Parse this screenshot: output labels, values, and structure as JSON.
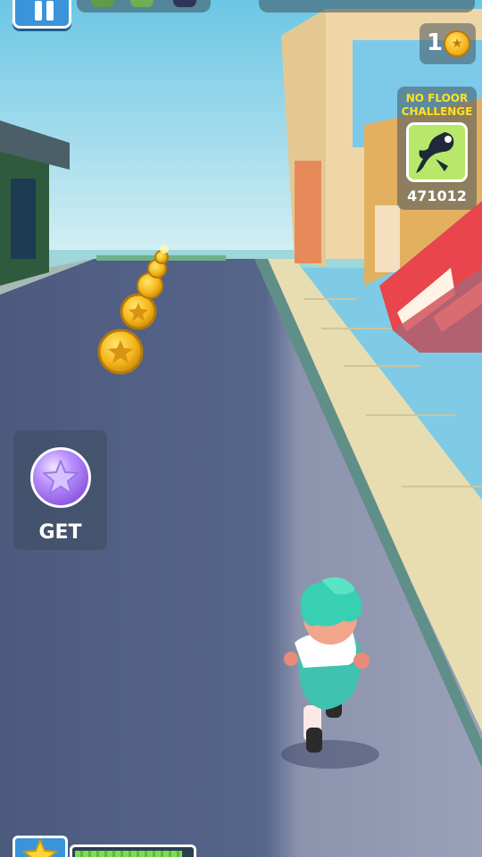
{
  "hud": {
    "coins": "1",
    "challenge_title": "NO FLOOR CHALLENGE",
    "challenge_score": "471012",
    "get_label": "GET",
    "progress": 0.92
  },
  "icons": {
    "pause": "pause-icon",
    "coin": "coin-icon",
    "challenge": "dragon-silhouette-icon",
    "powerup": "star-orb-icon",
    "boost": "star-icon"
  },
  "colors": {
    "sky": "#7fcbe6",
    "road": "#4f5d80",
    "coin": "#f4b31d",
    "challenge_text": "#ffe21f",
    "player_hair": "#37d0b3"
  }
}
